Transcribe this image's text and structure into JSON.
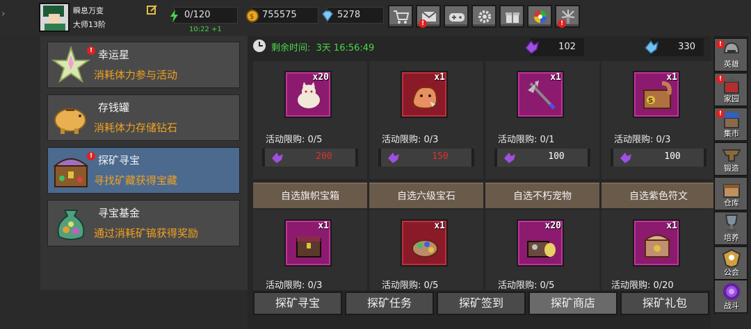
{
  "player": {
    "name": "瞬息万变",
    "rank": "大师13阶",
    "avatar": "hero-portrait"
  },
  "stats": {
    "stamina": "0/120",
    "stamina_regen": "10:22 +1",
    "gold": "755575",
    "diamond": "5278"
  },
  "top_icons": [
    "shop-cart-icon",
    "mail-icon",
    "gamepad-icon",
    "settings-gear-icon",
    "gift-icon",
    "color-wheel-icon",
    "firework-icon"
  ],
  "menu": [
    {
      "title": "幸运星",
      "desc": "消耗体力参与活动",
      "icon": "lucky-star-icon",
      "alert": "!"
    },
    {
      "title": "存钱罐",
      "desc": "消耗体力存储钻石",
      "icon": "piggy-bank-icon"
    },
    {
      "title": "探矿寻宝",
      "desc": "寻找矿藏获得宝藏",
      "icon": "treasure-chest-icon",
      "alert": "!"
    },
    {
      "title": "寻宝基金",
      "desc": "通过消耗矿镐获得奖励",
      "icon": "money-bag-icon"
    }
  ],
  "timer": {
    "label": "剩余时间:",
    "value": "3天 16:56:49"
  },
  "currencies": {
    "purple_crystal": "102",
    "blue_crystal": "330"
  },
  "items": [
    {
      "count": "x20",
      "limit": "活动限购: 0/5",
      "price": "200",
      "price_color": "#e03030",
      "icon": "white-cat-pet-icon"
    },
    {
      "count": "x1",
      "limit": "活动限购: 0/3",
      "price": "150",
      "price_color": "#e03030",
      "icon": "fox-pet-icon"
    },
    {
      "count": "x1",
      "limit": "活动限购: 0/1",
      "price": "100",
      "price_color": "#ffffff",
      "icon": "trident-weapon-icon"
    },
    {
      "count": "x1",
      "limit": "活动限购: 0/3",
      "price": "100",
      "price_color": "#ffffff",
      "icon": "squirrel-pet-icon"
    }
  ],
  "bands": [
    "自选旗帜宝箱",
    "自选六级宝石",
    "自选不朽宠物",
    "自选紫色符文"
  ],
  "items2": [
    {
      "count": "x1",
      "limit": "活动限购: 0/3",
      "icon": "chest-icon"
    },
    {
      "count": "x1",
      "limit": "活动限购: 0/5",
      "icon": "gem-pouch-icon"
    },
    {
      "count": "x20",
      "limit": "活动限购: 0/5",
      "icon": "pet-egg-icon"
    },
    {
      "count": "x1",
      "limit": "活动限购: 0/20",
      "icon": "rune-chest-icon"
    }
  ],
  "tabs": [
    {
      "label": "探矿寻宝"
    },
    {
      "label": "探矿任务"
    },
    {
      "label": "探矿签到"
    },
    {
      "label": "探矿商店",
      "selected": true
    },
    {
      "label": "探矿礼包"
    }
  ],
  "sidebar": [
    {
      "label": "英雄",
      "icon": "hero-helmet-icon",
      "alert": "!"
    },
    {
      "label": "家园",
      "icon": "home-castle-icon",
      "alert": "!"
    },
    {
      "label": "集市",
      "icon": "market-stall-icon",
      "alert": "!"
    },
    {
      "label": "锻造",
      "icon": "anvil-icon"
    },
    {
      "label": "仓库",
      "icon": "warehouse-icon"
    },
    {
      "label": "培养",
      "icon": "trophy-icon"
    },
    {
      "label": "公会",
      "icon": "guild-crest-icon"
    },
    {
      "label": "战斗",
      "icon": "battle-portal-icon"
    }
  ]
}
